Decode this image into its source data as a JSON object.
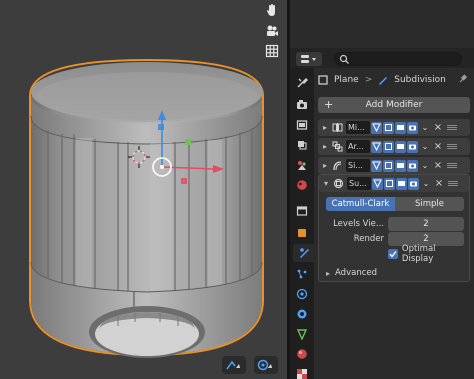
{
  "properties": {
    "search": {
      "placeholder": ""
    },
    "breadcrumb": {
      "object": "Plane",
      "modifier": "Subdivision"
    },
    "add_modifier_label": "Add Modifier",
    "tabs": [
      "tool-icon",
      "render-icon",
      "output-icon",
      "view-layer-icon",
      "scene-icon",
      "world-icon",
      "collection-icon",
      "object-icon",
      "modifier-icon",
      "particles-icon",
      "physics-icon",
      "constraints-icon",
      "data-icon",
      "material-icon",
      "texture-icon"
    ],
    "active_tab": "modifier-icon",
    "modifiers": [
      {
        "name": "Mi...",
        "icon": "mirror-icon",
        "expanded": false
      },
      {
        "name": "Ar...",
        "icon": "array-icon",
        "expanded": false
      },
      {
        "name": "Si...",
        "icon": "simple-deform-icon",
        "expanded": false
      },
      {
        "name": "Su...",
        "icon": "subdivision-icon",
        "expanded": true
      }
    ],
    "subdivision": {
      "method_options": [
        "Catmull-Clark",
        "Simple"
      ],
      "method_selected": "Catmull-Clark",
      "levels_viewport_label": "Levels Vie...",
      "levels_viewport_value": "2",
      "render_label": "Render",
      "render_value": "2",
      "optimal_display_label": "Optimal Display",
      "optimal_display_checked": true,
      "advanced_label": "Advanced"
    }
  },
  "colors": {
    "accent": "#4772b3",
    "selection_outline": "#e8902a",
    "x_axis": "#e84a5f",
    "y_axis": "#6ac259",
    "z_axis": "#3f8be0"
  }
}
